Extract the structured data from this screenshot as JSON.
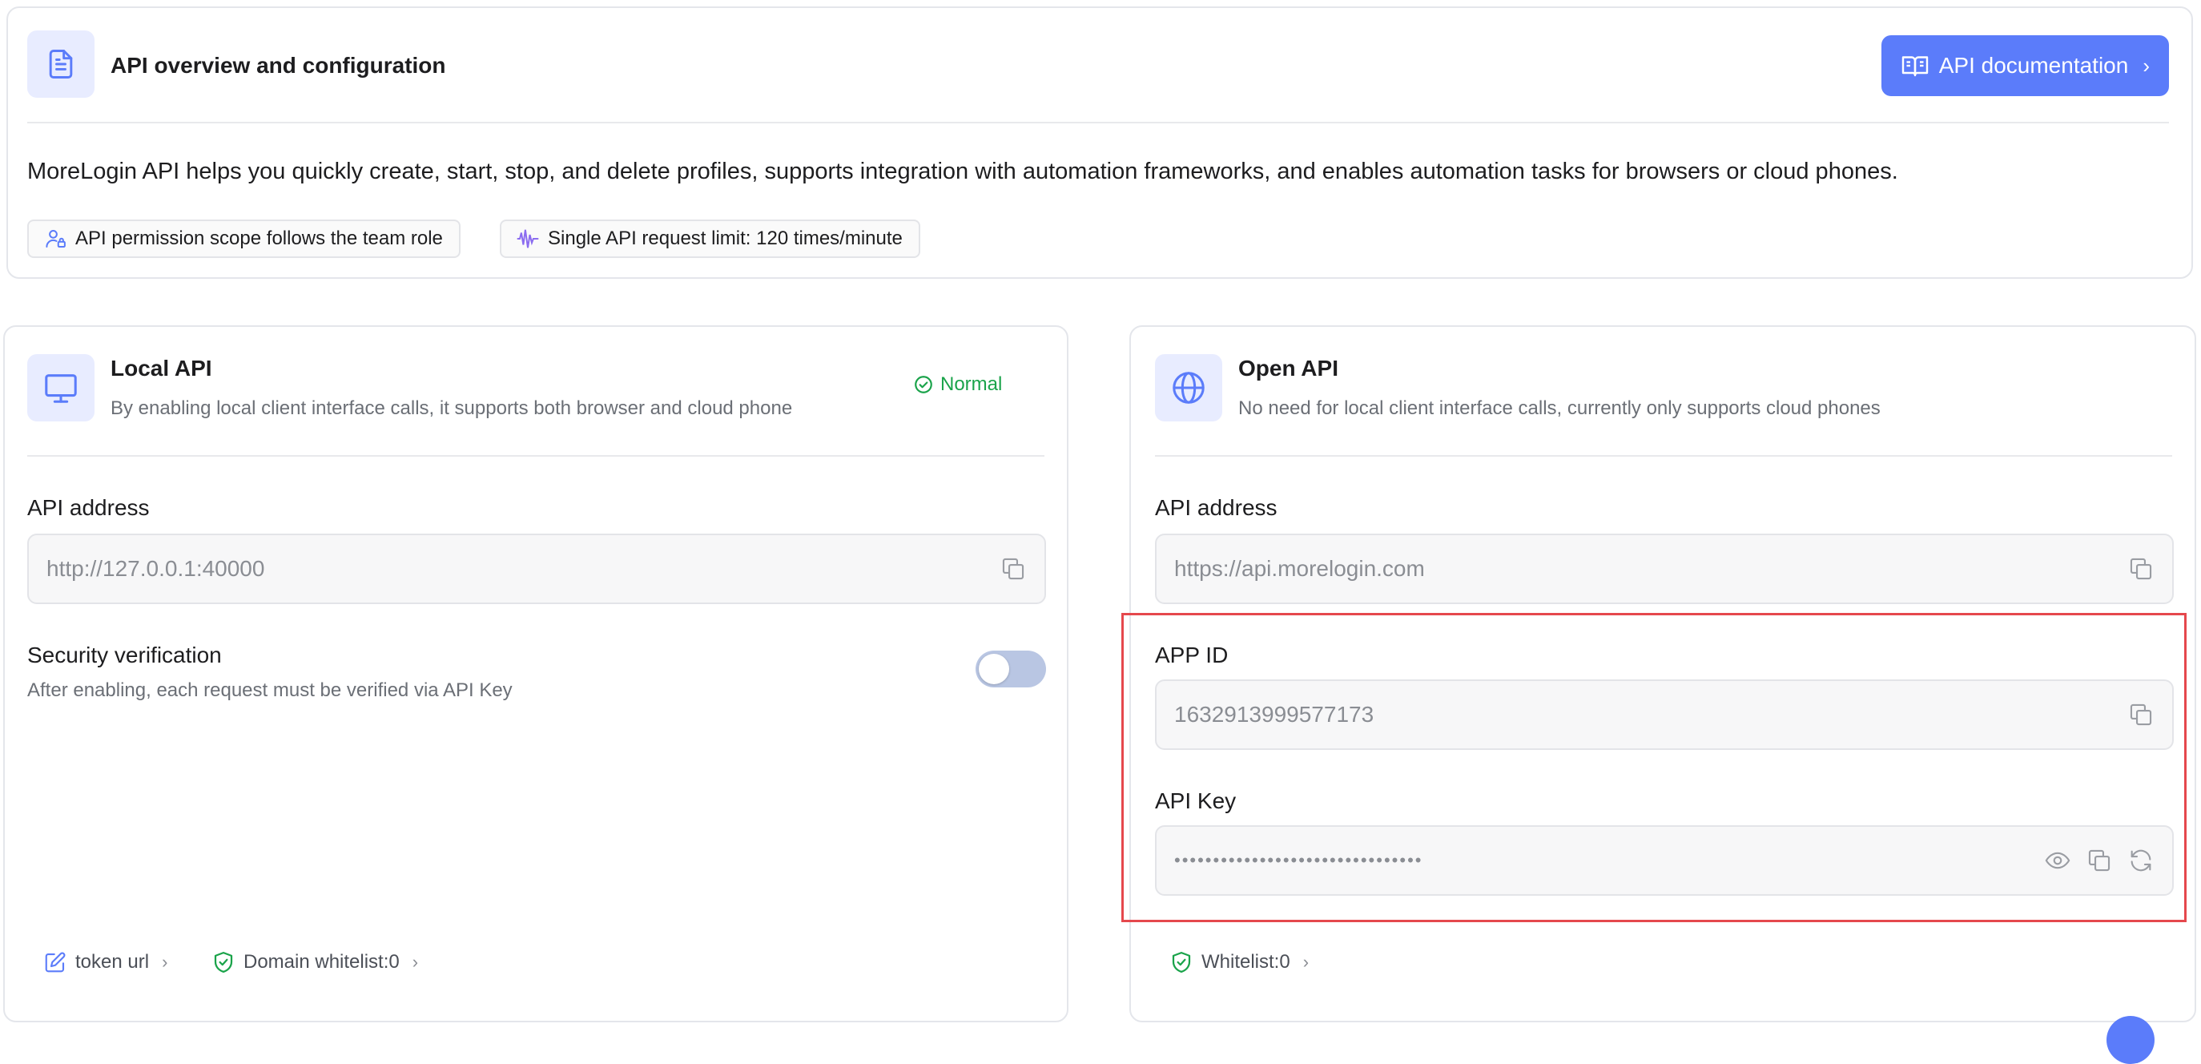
{
  "overview": {
    "title": "API overview and configuration",
    "doc_button": "API documentation",
    "description": "MoreLogin API helps you quickly create, start, stop, and delete profiles, supports integration with automation frameworks, and enables automation tasks for browsers or cloud phones.",
    "tags": [
      {
        "icon": "user-lock-icon",
        "label": "API permission scope follows the team role"
      },
      {
        "icon": "waveform-icon",
        "label": "Single API request limit: 120 times/minute"
      }
    ]
  },
  "local_api": {
    "title": "Local API",
    "subtitle": "By enabling local client interface calls, it supports both browser and cloud phone",
    "status": "Normal",
    "address_label": "API address",
    "address_value": "http://127.0.0.1:40000",
    "security_title": "Security verification",
    "security_desc": "After enabling, each request must be verified via API Key",
    "security_enabled": false,
    "token_link": "token url",
    "whitelist_link": "Domain whitelist:0"
  },
  "open_api": {
    "title": "Open API",
    "subtitle": "No need for local client interface calls, currently only supports cloud phones",
    "address_label": "API address",
    "address_value": "https://api.morelogin.com",
    "app_id_label": "APP ID",
    "app_id_value": "1632913999577173",
    "api_key_label": "API Key",
    "api_key_value": "••••••••••••••••••••••••••••••••",
    "whitelist_link": "Whitelist:0"
  },
  "colors": {
    "accent": "#5b7cfa",
    "success": "#1aa34a",
    "highlight": "#e5484d"
  }
}
